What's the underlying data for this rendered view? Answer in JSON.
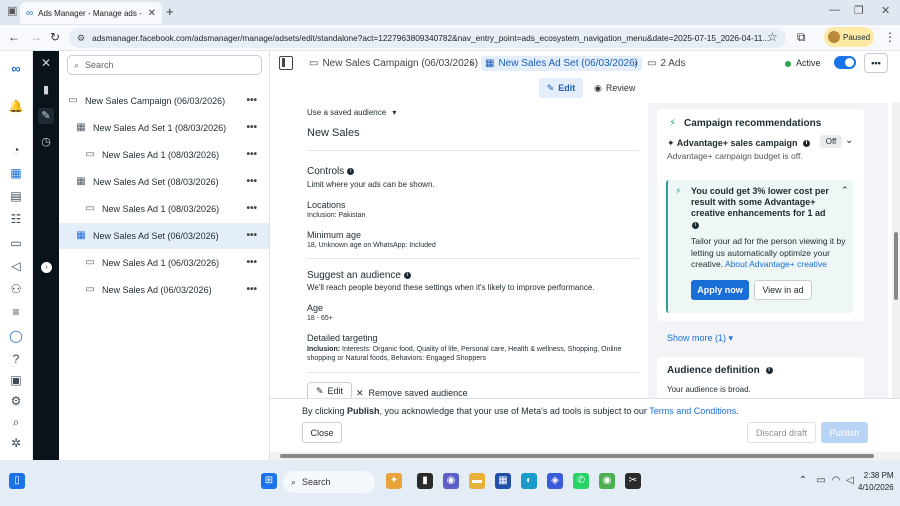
{
  "browser": {
    "tab_title": "Ads Manager - Manage ads - C",
    "url": "adsmanager.facebook.com/adsmanager/manage/adsets/edit/standalone?act=1227963809340782&nav_entry_point=ads_ecosystem_navigation_menu&date=2025-07-15_2026-04-11...",
    "profile_status": "Paused"
  },
  "tree": {
    "search_placeholder": "Search",
    "items": [
      {
        "label": "New Sales Campaign (06/03/2026)",
        "type": "campaign",
        "selected": false
      },
      {
        "label": "New Sales Ad Set 1 (08/03/2026)",
        "type": "adset",
        "selected": false
      },
      {
        "label": "New Sales Ad 1 (08/03/2026)",
        "type": "ad",
        "selected": false
      },
      {
        "label": "New Sales Ad Set (08/03/2026)",
        "type": "adset",
        "selected": false
      },
      {
        "label": "New Sales Ad 1 (08/03/2026)",
        "type": "ad",
        "selected": false
      },
      {
        "label": "New Sales Ad Set (06/03/2026)",
        "type": "adset",
        "selected": true
      },
      {
        "label": "New Sales Ad 1 (06/03/2026)",
        "type": "ad",
        "selected": false
      },
      {
        "label": "New Sales Ad (06/03/2026)",
        "type": "ad",
        "selected": false
      }
    ]
  },
  "breadcrumb": {
    "campaign": "New Sales Campaign (06/03/2026)",
    "adset": "New Sales Ad Set (06/03/2026)",
    "ads": "2 Ads"
  },
  "status": {
    "label": "Active",
    "toggle_on": true
  },
  "tabs": {
    "edit": "Edit",
    "review": "Review"
  },
  "editor": {
    "saved_audience_label": "Use a saved audience",
    "saved_audience_value": "New Sales",
    "controls_title": "Controls",
    "controls_desc": "Limit where your ads can be shown.",
    "locations_title": "Locations",
    "locations_value": "Inclusion: Pakistan",
    "min_age_title": "Minimum age",
    "min_age_value": "18, Unknown age on WhatsApp: Included",
    "suggest_title": "Suggest an audience",
    "suggest_desc": "We'll reach people beyond these settings when it's likely to improve performance.",
    "age_title": "Age",
    "age_value": "18 - 65+",
    "detailed_title": "Detailed targeting",
    "detailed_prefix": "Inclusion:",
    "detailed_line1": " Interests: Organic food, Quality of life, Personal care, Health & wellness, Shopping, Online",
    "detailed_line2": "shopping or Natural foods, Behaviors: Engaged Shoppers",
    "edit_button": "Edit",
    "remove_button": "Remove saved audience"
  },
  "recommendations": {
    "title": "Campaign recommendations",
    "advantage_title": "Advantage+ sales campaign",
    "advantage_state": "Off",
    "advantage_desc": "Advantage+ campaign budget is off.",
    "box_title_line1": "You could get 3% lower cost per",
    "box_title_line2": "result with some Advantage+",
    "box_title_line3": "creative enhancements for 1 ad",
    "box_desc_line1": "Tailor your ad for the person viewing it by",
    "box_desc_line2": "letting us automatically optimize your",
    "box_desc_line3": "creative.",
    "box_link": "About Advantage+ creative",
    "apply_button": "Apply now",
    "view_button": "View in ad",
    "show_more": "Show more (1)",
    "audience_title": "Audience definition",
    "audience_desc": "Your audience is broad."
  },
  "footer": {
    "message_pre": "By clicking ",
    "message_bold": "Publish",
    "message_mid": ", you acknowledge that your use of Meta's ad tools is subject to our ",
    "message_link": "Terms and Conditions",
    "message_end": ".",
    "close_button": "Close",
    "discard_button": "Discard draft",
    "publish_button": "Publish"
  },
  "taskbar": {
    "search_label": "Search",
    "time": "2:38 PM",
    "date": "4/10/2026"
  },
  "colors": {
    "accent": "#1a6ed8",
    "active": "#2da84f",
    "dark_rail": "#0a1317"
  }
}
